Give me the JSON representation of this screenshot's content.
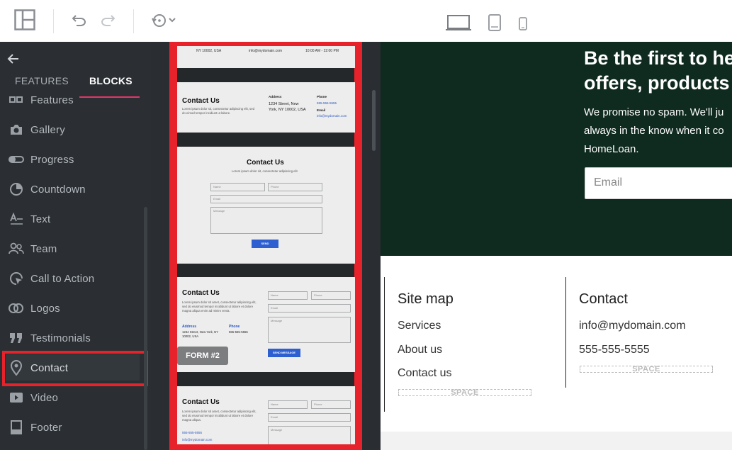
{
  "toolbar": {
    "layout_icon": "layout-grid-icon",
    "undo_icon": "undo-icon",
    "redo_icon": "redo-icon",
    "history_icon": "history-icon",
    "desktop_icon": "laptop-icon",
    "tablet_icon": "tablet-icon",
    "mobile_icon": "mobile-icon"
  },
  "sidebar": {
    "tabs": [
      {
        "label": "FEATURES"
      },
      {
        "label": "BLOCKS"
      }
    ],
    "items": [
      {
        "label": "Features",
        "icon": "features-icon"
      },
      {
        "label": "Gallery",
        "icon": "camera-icon"
      },
      {
        "label": "Progress",
        "icon": "progress-icon"
      },
      {
        "label": "Countdown",
        "icon": "countdown-icon"
      },
      {
        "label": "Text",
        "icon": "text-icon"
      },
      {
        "label": "Team",
        "icon": "team-icon"
      },
      {
        "label": "Call to Action",
        "icon": "cursor-icon"
      },
      {
        "label": "Logos",
        "icon": "logos-icon"
      },
      {
        "label": "Testimonials",
        "icon": "quote-icon"
      },
      {
        "label": "Contact",
        "icon": "location-pin-icon"
      },
      {
        "label": "Video",
        "icon": "video-icon"
      },
      {
        "label": "Footer",
        "icon": "footer-icon"
      }
    ]
  },
  "blocks": {
    "thumb0": {
      "address": "NY 10002, USA",
      "email": "info@mydomain.com",
      "hours": "10:00 AM - 22:00 PM"
    },
    "thumb1": {
      "title": "Contact Us",
      "lorem": "Lorem ipsum dolor sit, consectetur adipiscing elit, sed do eimod tempor incidiunt ut labore.",
      "address_label": "Address",
      "address": "1234 Street, New York, NY 10002, USA",
      "phone_label": "Phone",
      "phone": "555-555-5555",
      "email_label": "Email",
      "email": "info@mydomain.com"
    },
    "thumb2": {
      "title": "Contact Us",
      "lorem": "Lorem ipsum dolor sit, consectetur adipiscing elit",
      "name": "Name",
      "phone": "Phone",
      "email": "Email",
      "message": "Message",
      "button": "SEND"
    },
    "thumb3": {
      "title": "Contact Us",
      "lorem": "Lorem ipsum dolor sit amet, consectetur adipiscing elit, sed do eiusmod tempor incididunt ut labore et dolore magna aliqua enim ad minim venia.",
      "address_label": "Address",
      "address": "1234 Street, New York, NY 10002, USA",
      "phone_label": "Phone",
      "phone": "555-555-5555",
      "name": "Name",
      "phone_ph": "Phone",
      "email": "Email",
      "message": "Message",
      "button": "SEND MESSAGE",
      "badge": "FORM #2"
    },
    "thumb4": {
      "title": "Contact Us",
      "lorem": "Lorem ipsum dolor sit amet, consectetur adipiscing elit, sed do eiusmod tempor incididunt ut labore et dolore magna aliqua.",
      "phone": "555-555-5555",
      "email": "info@mydomain.com",
      "name": "Name",
      "phone_ph": "Phone",
      "email_ph": "Email",
      "message": "Message"
    }
  },
  "preview": {
    "hero_title_line1": "Be the first to he",
    "hero_title_line2": "offers, products",
    "hero_text_line1": "We promise no spam. We'll ju",
    "hero_text_line2": "always in the know when it co",
    "hero_text_line3": "HomeLoan.",
    "email_placeholder": "Email",
    "sitemap_heading": "Site map",
    "sitemap_links": [
      "Services",
      "About us",
      "Contact us"
    ],
    "contact_heading": "Contact",
    "contact_email": "info@mydomain.com",
    "contact_phone": "555-555-5555",
    "space_label": "SPACE"
  },
  "colors": {
    "accent": "#e5356b",
    "highlight": "#e8222b",
    "hero_bg": "#0f2a1f",
    "button_blue": "#2d5fd1"
  }
}
